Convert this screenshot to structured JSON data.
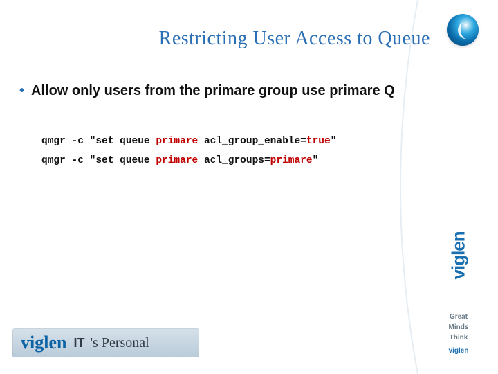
{
  "title": "Restricting User Access to Queue",
  "bullet_text": "Allow only users from the primare group use primare Q",
  "bullet_glyph": "•",
  "code": {
    "l1": {
      "a": "qmgr -c \"set queue ",
      "b": "primare",
      "c": " acl_group_enable=",
      "d": "true",
      "e": "\""
    },
    "l2": {
      "a": "qmgr -c \"set queue ",
      "b": "primare",
      "c": " acl_groups=",
      "d": "primare",
      "e": "\""
    }
  },
  "side_tag_1": "Great",
  "side_tag_2": "Minds",
  "side_tag_3": "Think",
  "side_brand_small": "viglen",
  "banner_brand": "viglen",
  "banner_it": "IT",
  "banner_tag": "'s Personal"
}
